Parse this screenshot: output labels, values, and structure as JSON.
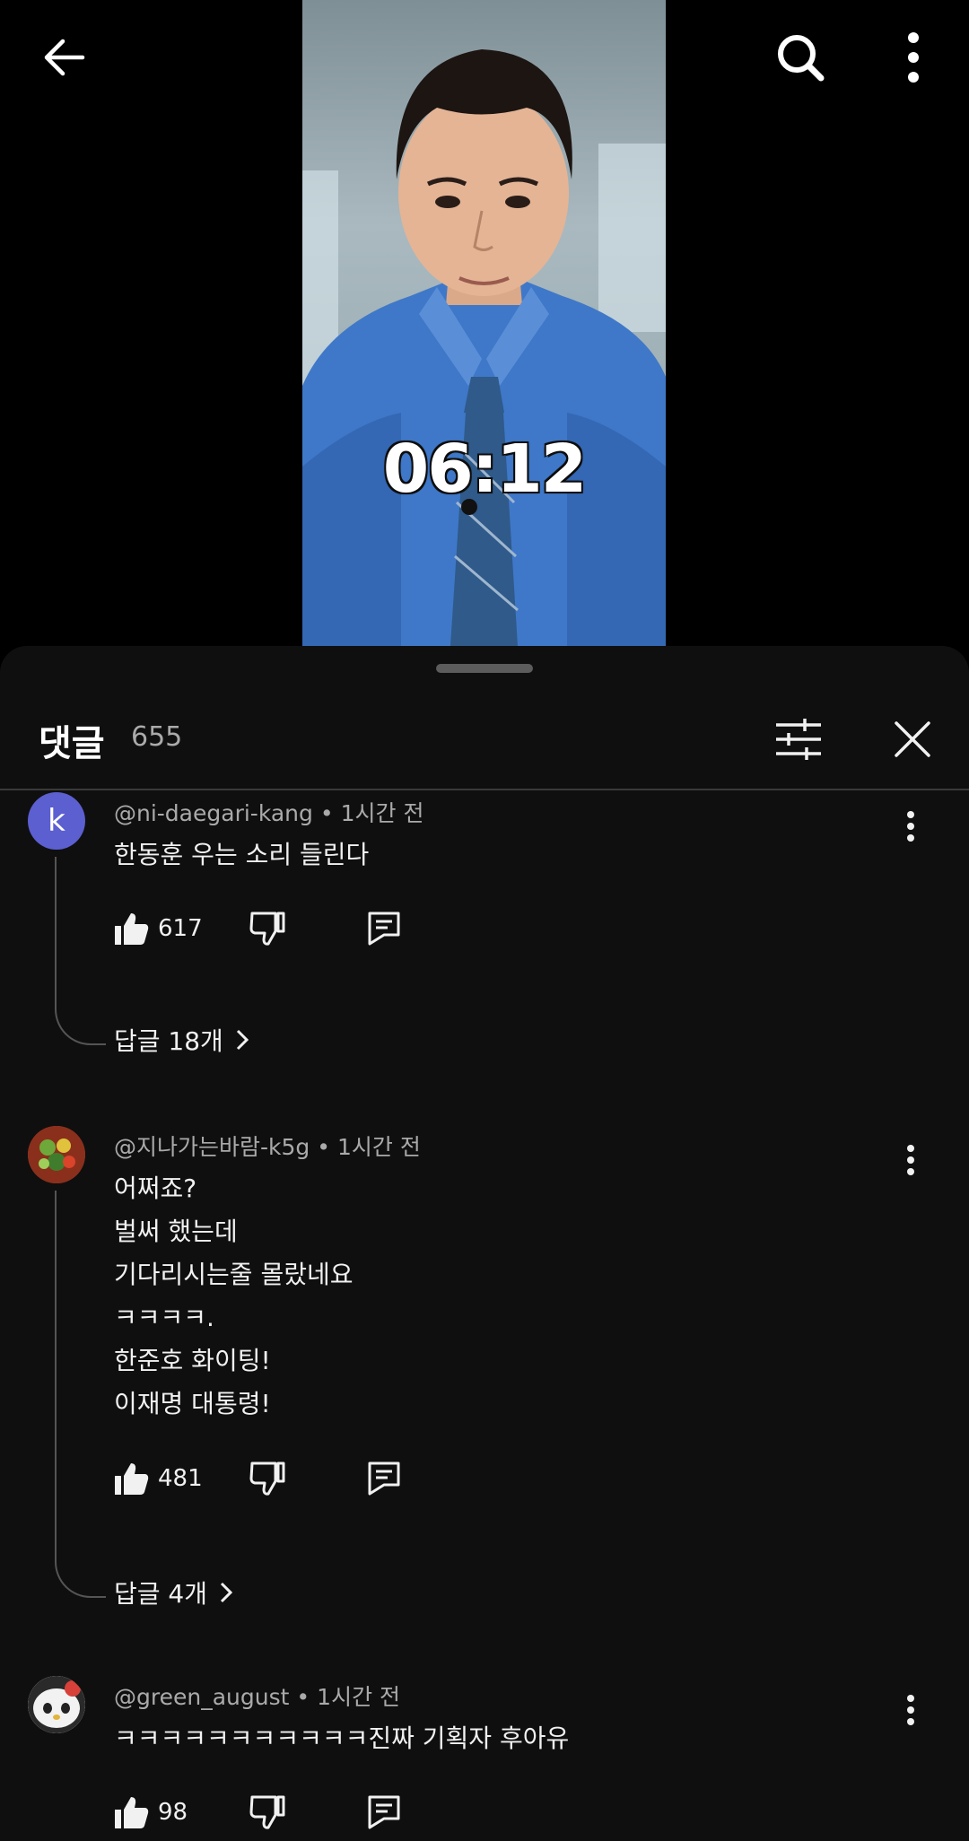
{
  "video": {
    "timer": "06:12",
    "icons": {
      "back": "back-arrow-icon",
      "search": "search-icon",
      "more": "more-vertical-icon"
    }
  },
  "comments_panel": {
    "title": "댓글",
    "count": "655",
    "icons": {
      "sort": "sort-filter-icon",
      "close": "close-icon"
    }
  },
  "comments": [
    {
      "avatar_letter": "k",
      "avatar_color": "#5c5fd0",
      "author": "@ni-daegari-kang",
      "time": "1시간 전",
      "lines": [
        "한동훈 우는 소리 들린다"
      ],
      "likes": "617",
      "replies": "답글 18개"
    },
    {
      "avatar_letter": "",
      "avatar_color": "#b8452a",
      "author": "@지나가는바람-k5g",
      "time": "1시간 전",
      "lines": [
        "어쩌죠?",
        "벌써 했는데",
        "기다리시는줄 몰랐네요",
        "ㅋㅋㅋㅋ.",
        "한준호 화이팅!",
        "이재명 대통령!"
      ],
      "likes": "481",
      "replies": "답글 4개"
    },
    {
      "avatar_letter": "",
      "avatar_color": "#e9e9e9",
      "author": "@green_august",
      "time": "1시간 전",
      "lines": [
        "ㅋㅋㅋㅋㅋㅋㅋㅋㅋㅋㅋ진짜 기획자 후아유"
      ],
      "likes": "98",
      "replies": ""
    }
  ]
}
